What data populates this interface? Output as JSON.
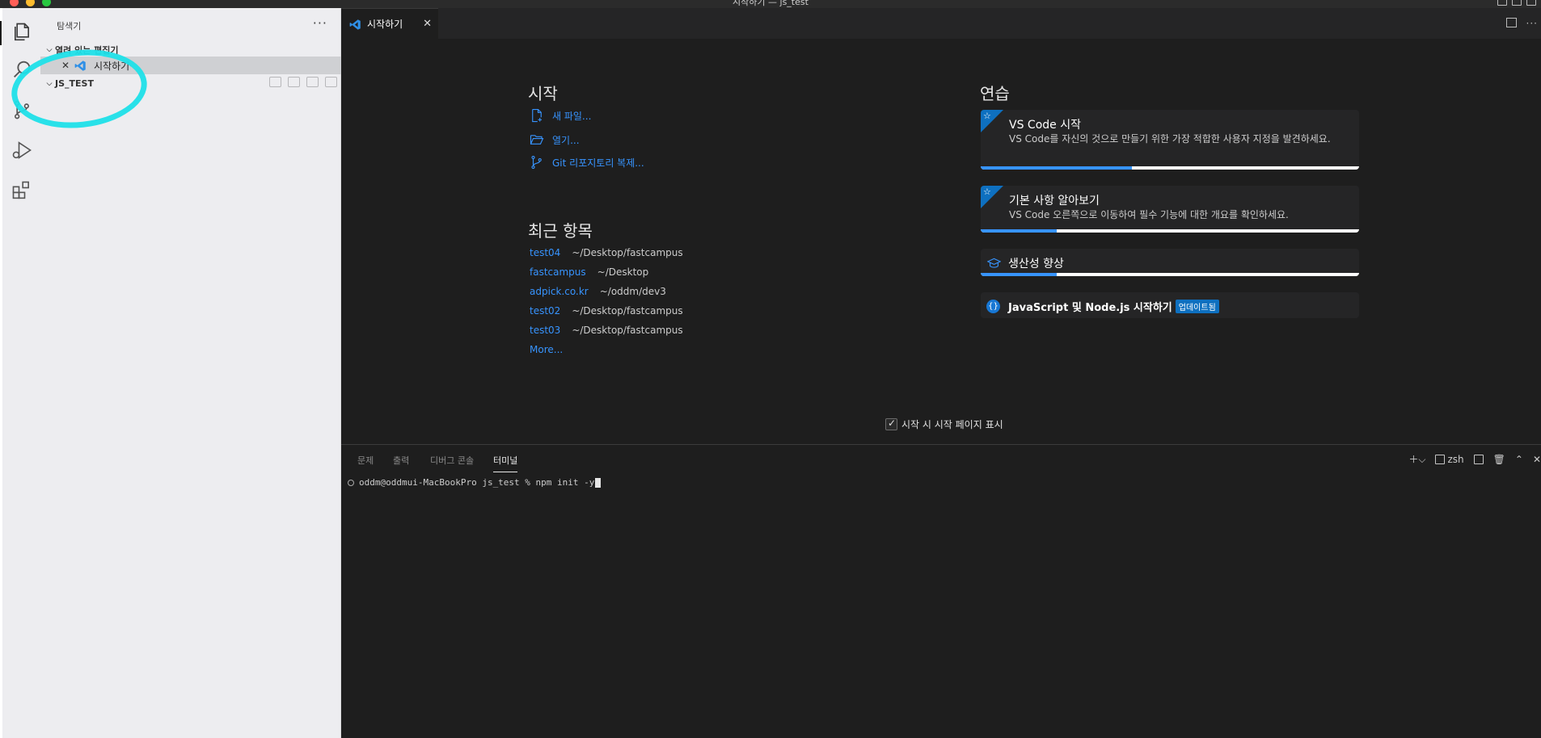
{
  "window": {
    "title": "시작하기 — js_test"
  },
  "sidebar": {
    "title": "탐색기",
    "more": "···",
    "open_editors_label": "열려 있는 편집기",
    "open_editor_item": "시작하기",
    "workspace_label": "JS_TEST"
  },
  "editor": {
    "tab_label": "시작하기",
    "more": "···"
  },
  "welcome": {
    "start_heading": "시작",
    "actions": [
      "새 파일...",
      "열기...",
      "Git 리포지토리 복제..."
    ],
    "recent_heading": "최근 항목",
    "recent": [
      {
        "name": "test04",
        "path": "~/Desktop/fastcampus"
      },
      {
        "name": "fastcampus",
        "path": "~/Desktop"
      },
      {
        "name": "adpick.co.kr",
        "path": "~/oddm/dev3"
      },
      {
        "name": "test02",
        "path": "~/Desktop/fastcampus"
      },
      {
        "name": "test03",
        "path": "~/Desktop/fastcampus"
      }
    ],
    "more_label": "More...",
    "practice_heading": "연습",
    "walkthroughs": [
      {
        "title": "VS Code 시작",
        "desc": "VS Code를 자신의 것으로 만들기 위한 가장 적합한 사용자 지정을 발견하세요.",
        "progress": 0.4
      },
      {
        "title": "기본 사항 알아보기",
        "desc": "VS Code 오른쪽으로 이동하여 필수 기능에 대한 개요를 확인하세요.",
        "progress": 0.2
      },
      {
        "title": "생산성 향상",
        "progress": 0.2
      },
      {
        "title": "JavaScript 및 Node.js 시작하기",
        "badge": "업데이트됨"
      }
    ],
    "show_on_startup": "시작 시 시작 페이지 표시"
  },
  "panel": {
    "tabs": [
      "문제",
      "출력",
      "디버그 콘솔",
      "터미널"
    ],
    "shell": "zsh",
    "terminal_line": "oddm@oddmui-MacBookPro js_test % npm init -y"
  },
  "colors": {
    "accent": "#3794ff",
    "annotation": "#1fe0e8"
  }
}
